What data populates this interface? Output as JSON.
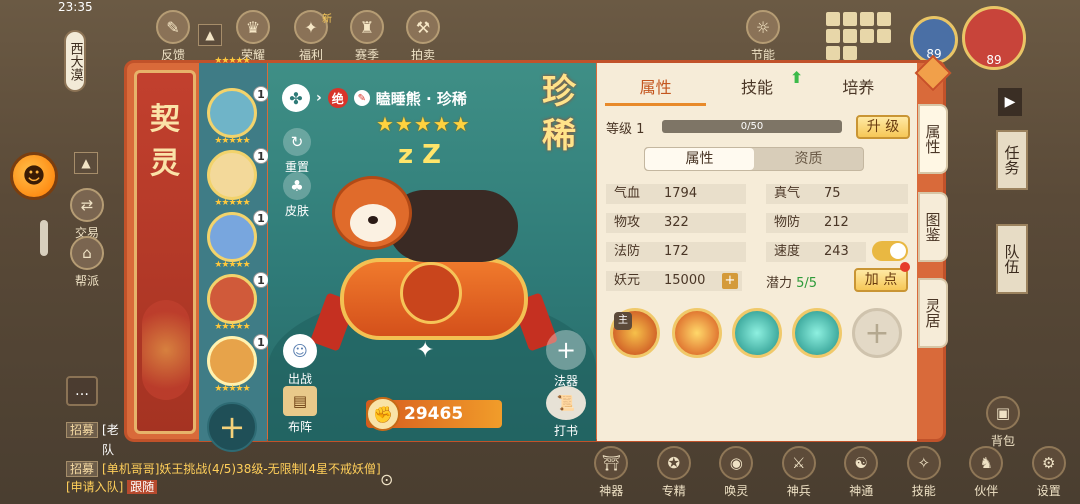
{
  "hud": {
    "time": "23:35",
    "region": "西大漠",
    "top_icons": [
      {
        "label": "反馈",
        "icon": "feedback-icon"
      },
      {
        "label": "荣耀",
        "icon": "glory-icon"
      },
      {
        "label": "福利",
        "icon": "gift-icon",
        "badge": "新"
      },
      {
        "label": "赛季",
        "icon": "trophy-icon"
      },
      {
        "label": "拍卖",
        "icon": "hammer-icon"
      },
      {
        "label": "节能",
        "icon": "bulb-icon"
      }
    ],
    "side_buttons": [
      {
        "label": "交易",
        "icon": "trade-icon"
      },
      {
        "label": "帮派",
        "icon": "guild-icon"
      }
    ],
    "avatar_levels": [
      "89",
      "89"
    ],
    "right_tabs": [
      "任务",
      "队伍"
    ],
    "bottom_bar": [
      {
        "label": "神器",
        "icon": "artifact-icon"
      },
      {
        "label": "专精",
        "icon": "mastery-icon"
      },
      {
        "label": "唤灵",
        "icon": "summon-icon"
      },
      {
        "label": "神兵",
        "icon": "weapon-icon"
      },
      {
        "label": "神通",
        "icon": "power-icon"
      },
      {
        "label": "技能",
        "icon": "skill-icon"
      },
      {
        "label": "伙伴",
        "icon": "partner-icon"
      },
      {
        "label": "设置",
        "icon": "settings-icon"
      }
    ],
    "backpack_label": "背包",
    "chat": [
      {
        "tag": "招募",
        "text": "[老"
      },
      {
        "tag": "",
        "text": "队"
      },
      {
        "tag": "招募",
        "text": "[单机哥哥]妖王挑战(4/5)38级-无限制[4星不戒妖僧][申请入队]",
        "join": "跟随"
      }
    ]
  },
  "dialog": {
    "title": "契灵",
    "rarity": "珍稀",
    "roster": [
      {
        "level": "1",
        "color": "#6fb4c8"
      },
      {
        "level": "1",
        "color": "#f3d99a"
      },
      {
        "level": "1",
        "color": "#78a6de"
      },
      {
        "level": "1",
        "color": "#d05a3a"
      },
      {
        "level": "1",
        "color": "#e7a34a"
      }
    ],
    "pet": {
      "rank_badge": "绝",
      "name": "瞌睡熊 · 珍稀",
      "stars": "★★★★★"
    },
    "tools": [
      {
        "label": "重置",
        "icon": "reset-icon"
      },
      {
        "label": "皮肤",
        "icon": "skin-icon"
      },
      {
        "label": "出战",
        "icon": "deploy-icon"
      },
      {
        "label": "布阵",
        "icon": "formation-icon"
      },
      {
        "label": "法器",
        "icon": "add-icon"
      },
      {
        "label": "打书",
        "icon": "scroll-icon"
      }
    ],
    "power": "29465",
    "tabs": [
      "属性",
      "技能",
      "培养"
    ],
    "level_label": "等级 1",
    "xp_text": "0/50",
    "upgrade_btn": "升 级",
    "subtabs": [
      "属性",
      "资质"
    ],
    "stats": [
      {
        "k": "气血",
        "v": "1794"
      },
      {
        "k": "真气",
        "v": "75"
      },
      {
        "k": "物攻",
        "v": "322"
      },
      {
        "k": "物防",
        "v": "212"
      },
      {
        "k": "法防",
        "v": "172"
      },
      {
        "k": "速度",
        "v": "243"
      }
    ],
    "yaoyuan": {
      "k": "妖元",
      "v": "15000"
    },
    "potential_label": "潜力",
    "potential_value": "5/5",
    "add_point_btn": "加 点",
    "skill_main_tag": "主",
    "side_tabs": [
      "属性",
      "图鉴",
      "灵居"
    ],
    "colors": {
      "accent": "#e88a2a",
      "dialog_border": "#d96a3a",
      "stage": "#2f7b78"
    }
  }
}
